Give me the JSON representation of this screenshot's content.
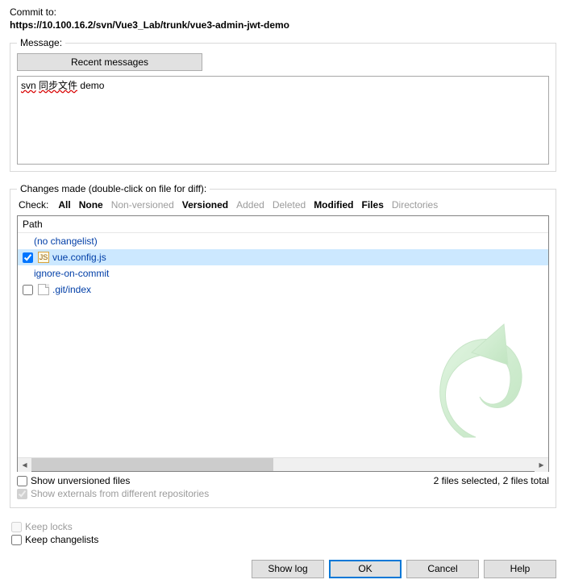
{
  "header": {
    "commit_to_label": "Commit to:",
    "commit_url": "https://10.100.16.2/svn/Vue3_Lab/trunk/vue3-admin-jwt-demo"
  },
  "message_group": {
    "legend": "Message:",
    "recent_button": "Recent messages",
    "text_plain": "svn 同步文件 demo",
    "word1": "svn",
    "word2": "同步文件",
    "word3": "demo"
  },
  "changes": {
    "label": "Changes made (double-click on file for diff):",
    "check_label": "Check:",
    "filters": {
      "all": "All",
      "none": "None",
      "non_versioned": "Non-versioned",
      "versioned": "Versioned",
      "added": "Added",
      "deleted": "Deleted",
      "modified": "Modified",
      "files": "Files",
      "directories": "Directories"
    },
    "path_header": "Path",
    "groups": {
      "no_changelist": "(no changelist)",
      "ignore_on_commit": "ignore-on-commit"
    },
    "items": [
      {
        "name": "vue.config.js",
        "checked": true,
        "selected": true,
        "icon": "js"
      },
      {
        "name": ".git/index",
        "checked": false,
        "selected": false,
        "icon": "file"
      }
    ],
    "show_unversioned": "Show unversioned files",
    "show_externals": "Show externals from different repositories",
    "status": "2 files selected, 2 files total"
  },
  "options": {
    "keep_locks": "Keep locks",
    "keep_changelists": "Keep changelists"
  },
  "buttons": {
    "show_log": "Show log",
    "ok": "OK",
    "cancel": "Cancel",
    "help": "Help"
  }
}
